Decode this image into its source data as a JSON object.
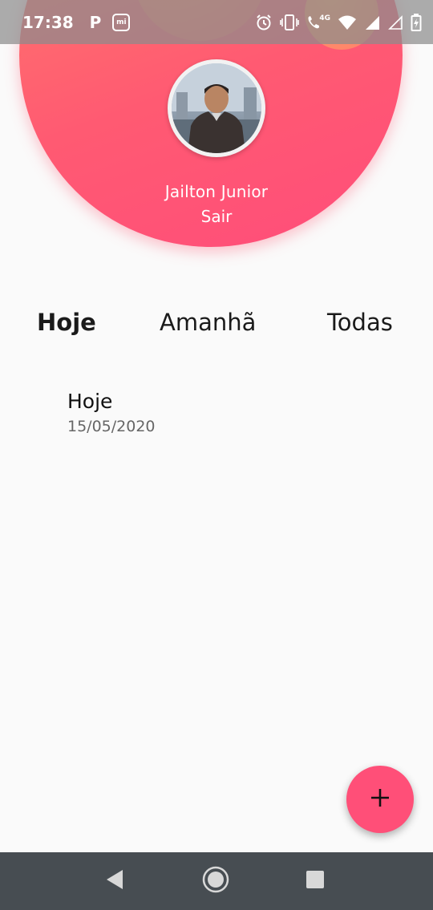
{
  "status_bar": {
    "time": "17:38",
    "notification_p": "P",
    "notification_mi": "mi",
    "network_label": "4G",
    "icons": [
      "alarm-icon",
      "vibrate-icon",
      "volte-call-icon",
      "wifi-icon",
      "signal-icon",
      "signal-empty-icon",
      "battery-charging-icon"
    ]
  },
  "header": {
    "user_name": "Jailton Junior",
    "logout_label": "Sair",
    "gradient_colors": [
      "#ff7e6a",
      "#ff4d7a"
    ]
  },
  "tabs": [
    {
      "label": "Hoje",
      "active": true
    },
    {
      "label": "Amanhã",
      "active": false
    },
    {
      "label": "Todas",
      "active": false
    }
  ],
  "tasks": [
    {
      "title": "Hoje",
      "date": "15/05/2020"
    }
  ],
  "fab": {
    "icon": "plus-icon",
    "color": "#ff4f78"
  },
  "nav_bar": {
    "icons": [
      "back-icon",
      "home-icon",
      "recents-icon"
    ],
    "color": "#474d52"
  }
}
